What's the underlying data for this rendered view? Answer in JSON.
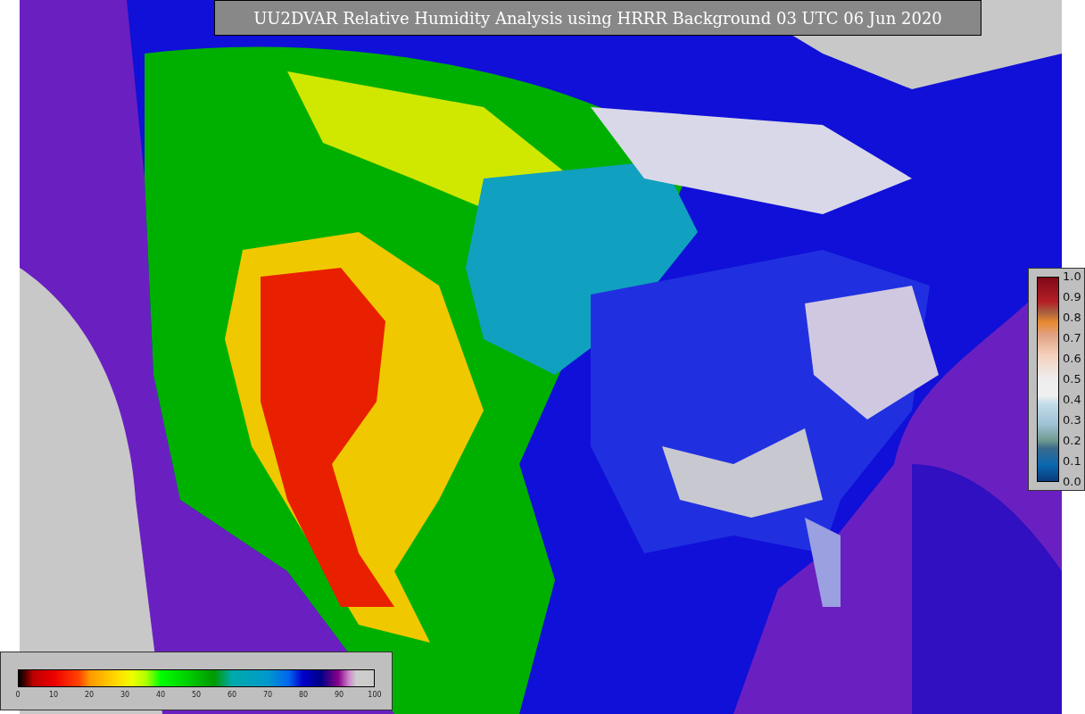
{
  "title": "UU2DVAR Relative Humidity Analysis using HRRR Background 03 UTC 06 Jun 2020",
  "humidity_colorbar": {
    "tick_labels": [
      "0",
      "10",
      "20",
      "30",
      "40",
      "50",
      "60",
      "70",
      "80",
      "90",
      "100"
    ]
  },
  "observation_colorbar": {
    "tick_labels": [
      "1.0",
      "0.9",
      "0.8",
      "0.7",
      "0.6",
      "0.5",
      "0.4",
      "0.3",
      "0.2",
      "0.1",
      "0.0"
    ]
  }
}
